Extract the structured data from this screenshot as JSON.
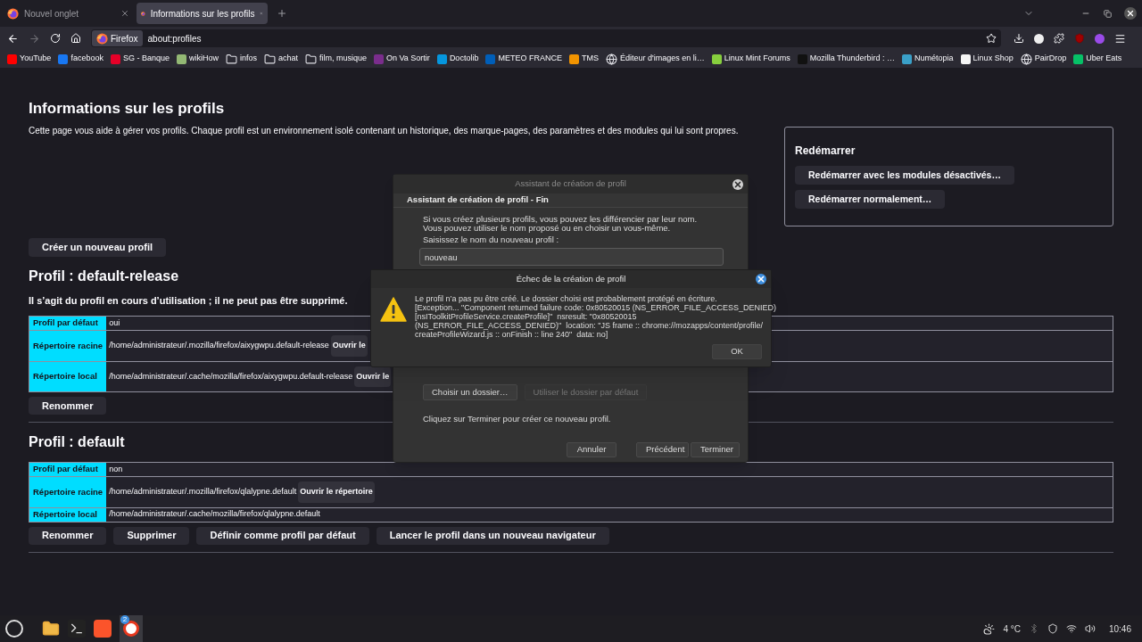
{
  "browser": {
    "tabs": [
      {
        "title": "Nouvel onglet",
        "selected": false
      },
      {
        "title": "Informations sur les profils",
        "selected": true
      }
    ],
    "identity_label": "Firefox",
    "url": "about:profiles",
    "bookmarks": [
      {
        "label": "YouTube",
        "kind": "favicon",
        "color": "#ff0000"
      },
      {
        "label": "facebook",
        "kind": "favicon",
        "color": "#1877f2"
      },
      {
        "label": "SG - Banque",
        "kind": "favicon",
        "color": "#e60028"
      },
      {
        "label": "wikiHow",
        "kind": "favicon",
        "color": "#93b874"
      },
      {
        "label": "infos",
        "kind": "folder"
      },
      {
        "label": "achat",
        "kind": "folder"
      },
      {
        "label": "film, musique",
        "kind": "folder"
      },
      {
        "label": "On Va Sortir",
        "kind": "favicon",
        "color": "#7a2d8c"
      },
      {
        "label": "Doctolib",
        "kind": "favicon",
        "color": "#0596de"
      },
      {
        "label": "METEO FRANCE",
        "kind": "favicon",
        "color": "#005eb8"
      },
      {
        "label": "TMS",
        "kind": "favicon",
        "color": "#f29400"
      },
      {
        "label": "Éditeur d'images en li…",
        "kind": "globe"
      },
      {
        "label": "Linux Mint Forums",
        "kind": "favicon",
        "color": "#87cf3e"
      },
      {
        "label": "Mozilla Thunderbird : …",
        "kind": "favicon",
        "color": "#111111"
      },
      {
        "label": "Numétopia",
        "kind": "favicon",
        "color": "#3aa0c8"
      },
      {
        "label": "Linux Shop",
        "kind": "favicon",
        "color": "#f5f5f5"
      },
      {
        "label": "PairDrop",
        "kind": "globe"
      },
      {
        "label": "Uber Eats",
        "kind": "favicon",
        "color": "#06c167"
      }
    ]
  },
  "page": {
    "title": "Informations sur les profils",
    "description": "Cette page vous aide à gérer vos profils. Chaque profil est un environnement isolé contenant un historique, des marque-pages, des paramètres et des modules qui lui sont propres.",
    "create_button": "Créer un nouveau profil",
    "restart": {
      "title": "Redémarrer",
      "buttons": [
        "Redémarrer avec les modules désactivés…",
        "Redémarrer normalement…"
      ]
    },
    "profiles": [
      {
        "heading": "Profil : default-release",
        "note": "Il s’agit du profil en cours d’utilisation ; il ne peut pas être supprimé.",
        "rows": [
          {
            "label": "Profil par défaut",
            "value": "oui"
          },
          {
            "label": "Répertoire racine",
            "value": "/home/administrateur/.mozilla/firefox/aixygwpu.default-release",
            "button": "Ouvrir le"
          },
          {
            "label": "Répertoire local",
            "value": "/home/administrateur/.cache/mozilla/firefox/aixygwpu.default-release",
            "button": "Ouvrir le"
          }
        ],
        "buttons": [
          "Renommer"
        ]
      },
      {
        "heading": "Profil : default",
        "rows": [
          {
            "label": "Profil par défaut",
            "value": "non"
          },
          {
            "label": "Répertoire racine",
            "value": "/home/administrateur/.mozilla/firefox/qlalypne.default",
            "button": "Ouvrir le répertoire"
          },
          {
            "label": "Répertoire local",
            "value": "/home/administrateur/.cache/mozilla/firefox/qlalypne.default"
          }
        ],
        "buttons": [
          "Renommer",
          "Supprimer",
          "Définir comme profil par défaut",
          "Lancer le profil dans un nouveau navigateur"
        ]
      }
    ]
  },
  "wizard": {
    "title": "Assistant de création de profil",
    "header": "Assistant de création de profil - Fin",
    "intro": "Si vous créez plusieurs profils, vous pouvez les différencier par leur nom. Vous pouvez utiliser le nom proposé ou en choisir un vous-même.",
    "name_label": "Saisissez le nom du nouveau profil :",
    "name_value": "nouveau",
    "folder_buttons": [
      {
        "label": "Choisir un dossier…",
        "disabled": false
      },
      {
        "label": "Utiliser le dossier par défaut",
        "disabled": true
      }
    ],
    "finish_text": "Cliquez sur Terminer pour créer ce nouveau profil.",
    "footer_buttons": [
      "Annuler",
      "Précédent",
      "Terminer"
    ]
  },
  "error_dialog": {
    "title": "Échec de la création de profil",
    "message": "Le profil n’a pas pu être créé. Le dossier choisi est probablement protégé en écriture.\n[Exception... \"Component returned failure code: 0x80520015 (NS_ERROR_FILE_ACCESS_DENIED)\n[nsIToolkitProfileService.createProfile]\"  nsresult: \"0x80520015\n(NS_ERROR_FILE_ACCESS_DENIED)\"  location: \"JS frame :: chrome://mozapps/content/profile/\ncreateProfileWizard.js :: onFinish :: line 240\"  data: no]",
    "ok": "OK"
  },
  "taskbar": {
    "badge": "2",
    "temperature": "4 °C",
    "clock": "10:46"
  }
}
